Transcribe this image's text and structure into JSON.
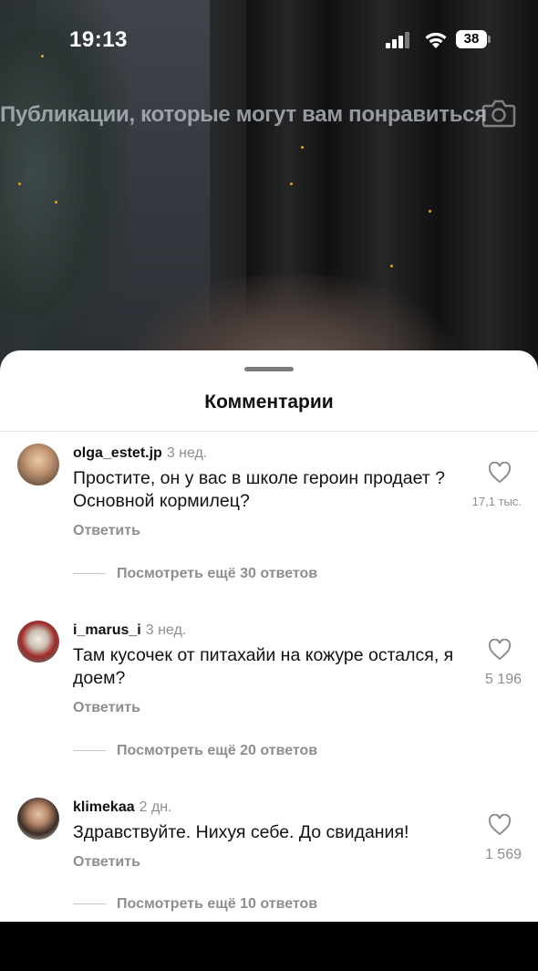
{
  "status": {
    "time": "19:13",
    "battery": "38"
  },
  "overlay": {
    "title": "Публикации, которые могут вам понравиться"
  },
  "sheet": {
    "title": "Комментарии"
  },
  "comments": [
    {
      "username": "olga_estet.jp",
      "ago": "3 нед.",
      "text": "Простите, он у вас в школе героин продает ?  Основной кормилец?",
      "reply": "Ответить",
      "likes": "17,1 тыс.",
      "more": "Посмотреть ещё 30 ответов"
    },
    {
      "username": "i_marus_i",
      "ago": "3 нед.",
      "text": "Там кусочек от питахайи на кожуре остался, я доем?",
      "reply": "Ответить",
      "likes": "5 196",
      "more": "Посмотреть ещё 20 ответов"
    },
    {
      "username": "klimekaa",
      "ago": "2 дн.",
      "text": "Здравствуйте. Нихуя себе.  До свидания!",
      "reply": "Ответить",
      "likes": "1 569",
      "more": "Посмотреть ещё 10 ответов"
    }
  ]
}
